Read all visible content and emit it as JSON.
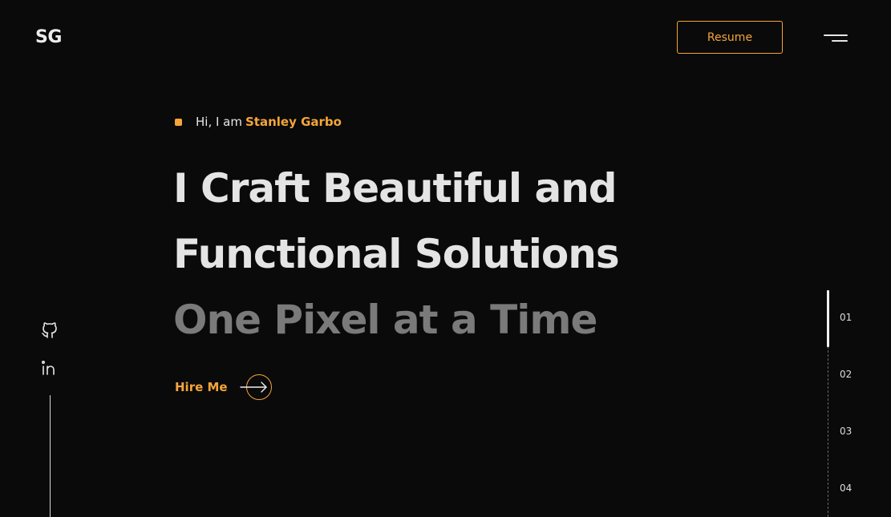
{
  "header": {
    "logo": "SG",
    "resume_label": "Resume",
    "menu_icon": "hamburger-menu-icon"
  },
  "hero": {
    "greeting": "Hi, I am",
    "name": "Stanley Garbo",
    "headline": [
      "I Craft Beautiful and",
      "Functional Solutions",
      "One Pixel at a Time"
    ],
    "cta_label": "Hire Me",
    "cta_icon": "arrow-right-circle-icon"
  },
  "social": [
    {
      "icon": "github-icon"
    },
    {
      "icon": "linkedin-icon"
    }
  ],
  "section_nav": {
    "items": [
      "01",
      "02",
      "03",
      "04"
    ],
    "active": "01"
  },
  "colors": {
    "background": "#0a0a0a",
    "accent": "#f5a53b",
    "text": "#e6e6e6",
    "muted_headline": "#7a7a7a"
  }
}
